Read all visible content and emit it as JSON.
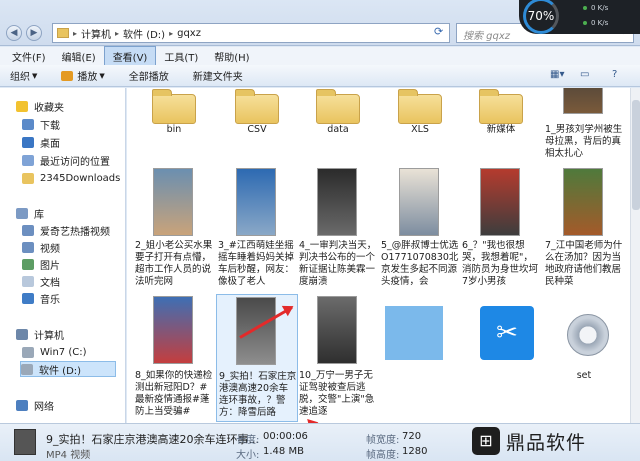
{
  "address": {
    "segments": [
      "计算机",
      "软件 (D:)",
      "gqxz"
    ]
  },
  "search": {
    "placeholder": "搜索 gqxz"
  },
  "perf": {
    "percent": "70%",
    "up": "0 K/s",
    "down": "0 K/s"
  },
  "menu": [
    "文件(F)",
    "编辑(E)",
    "查看(V)",
    "工具(T)",
    "帮助(H)"
  ],
  "toolbar": {
    "organize": "组织",
    "play": "播放",
    "play_all": "全部播放",
    "new_folder": "新建文件夹"
  },
  "nav": {
    "favorites": "收藏夹",
    "downloads": "下载",
    "desktop": "桌面",
    "recent": "最近访问的位置",
    "downloads2345": "2345Downloads",
    "library": "库",
    "iqiyi": "爱奇艺热播视频",
    "video": "视频",
    "pictures": "图片",
    "documents": "文档",
    "music": "音乐",
    "computer": "计算机",
    "win7": "Win7 (C:)",
    "software": "软件 (D:)",
    "network": "网络"
  },
  "files": [
    {
      "label": "bin"
    },
    {
      "label": "CSV"
    },
    {
      "label": "data"
    },
    {
      "label": "XLS"
    },
    {
      "label": "新媒体"
    },
    {
      "label": "1_男孩刘学州被生母拉黑，背后的真相太扎心"
    },
    {
      "label": "2_姐小老公买水果要子打开有点懵，超市工作人员的说法听完网"
    },
    {
      "label": "3_#江西萌娃坐摇摇车睡着妈妈关掉车后秒醒，网友：像极了老人"
    },
    {
      "label": "4_一审判决当天，判决书公布的一个新证据让陈美霖一度崩溃"
    },
    {
      "label": "5_@胖叔博士优选O1771070830北京发生多起不同源头疫情，会"
    },
    {
      "label": "6_？\"我也很想哭，我想着呢\"，消防员为身世坎坷7岁小男孩"
    },
    {
      "label": "7_江中国老师为什么在汤加？因为当地政府请他们教居民种菜"
    },
    {
      "label": "8_如果你的快递检测出新冠阳D？#最新疫情通报#蓬防上当受骗#"
    },
    {
      "label": "9_实拍！石家庄京港澳高速20余车连环事故，？警方：降雪后路"
    },
    {
      "label": "10_万宁一男子无证驾驶被查后逃脱，交警\"上演\"急速追逐"
    },
    {
      "label": ""
    },
    {
      "label": ""
    },
    {
      "label": "set"
    }
  ],
  "details": {
    "filename": "9_实拍！石家庄京港澳高速20余车连环事...",
    "filetype": "MP4 视频",
    "duration_key": "长度:",
    "duration_val": "00:00:06",
    "size_key": "大小:",
    "size_val": "1.48 MB",
    "width_key": "帧宽度:",
    "width_val": "720",
    "height_key": "帧高度:",
    "height_val": "1280"
  },
  "watermark": {
    "text": "鼎品软件"
  },
  "colors": {
    "accent": "#2e8bd6",
    "selection": "#cce4fb",
    "arrow": "#e32a2a",
    "folder": "#e9c45f"
  }
}
